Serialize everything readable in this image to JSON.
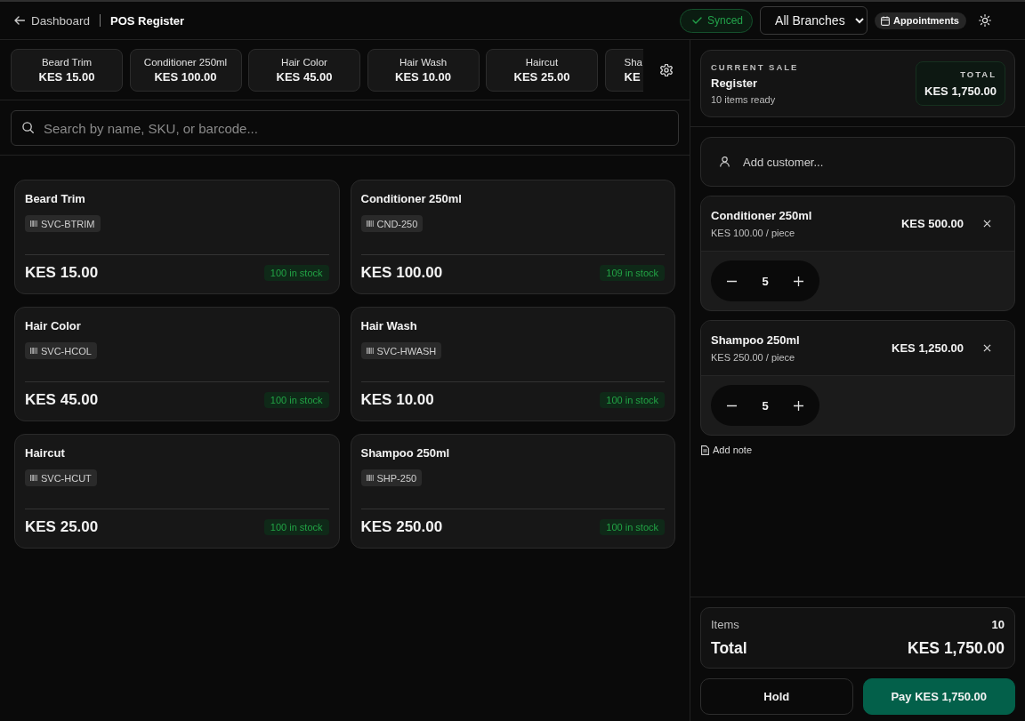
{
  "header": {
    "back_link": "Dashboard",
    "title": "POS Register",
    "sync_status": {
      "label": "Synced",
      "synced": true
    },
    "branch_select": {
      "value": "All Branches"
    },
    "appointments_button": "Appointments"
  },
  "quick_items": [
    {
      "name": "Beard Trim",
      "price": "KES 15.00",
      "cut_off": false
    },
    {
      "name": "Conditioner 250ml",
      "price": "KES 100.00",
      "cut_off": false
    },
    {
      "name": "Hair Color",
      "price": "KES 45.00",
      "cut_off": false
    },
    {
      "name": "Hair Wash",
      "price": "KES 10.00",
      "cut_off": false
    },
    {
      "name": "Haircut",
      "price": "KES 25.00",
      "cut_off": false
    },
    {
      "name": "Sha",
      "price": "KE",
      "cut_off": true
    }
  ],
  "search": {
    "placeholder": "Search by name, SKU, or barcode..."
  },
  "products": [
    {
      "name": "Beard Trim",
      "sku": "SVC-BTRIM",
      "price": "KES 15.00",
      "stock": "100 in stock"
    },
    {
      "name": "Conditioner 250ml",
      "sku": "CND-250",
      "price": "KES 100.00",
      "stock": "109 in stock"
    },
    {
      "name": "Hair Color",
      "sku": "SVC-HCOL",
      "price": "KES 45.00",
      "stock": "100 in stock"
    },
    {
      "name": "Hair Wash",
      "sku": "SVC-HWASH",
      "price": "KES 10.00",
      "stock": "100 in stock"
    },
    {
      "name": "Haircut",
      "sku": "SVC-HCUT",
      "price": "KES 25.00",
      "stock": "100 in stock"
    },
    {
      "name": "Shampoo 250ml",
      "sku": "SHP-250",
      "price": "KES 250.00",
      "stock": "100 in stock"
    }
  ],
  "current_sale": {
    "label": "CURRENT SALE",
    "title": "Register",
    "subtitle": "10 items ready",
    "total_label": "TOTAL",
    "total": "KES 1,750.00"
  },
  "customer": {
    "placeholder": "Add customer..."
  },
  "cart": [
    {
      "name": "Conditioner 250ml",
      "unit_price": "KES 100.00 / piece",
      "line_total": "KES 500.00",
      "quantity": "5"
    },
    {
      "name": "Shampoo 250ml",
      "unit_price": "KES 250.00 / piece",
      "line_total": "KES 1,250.00",
      "quantity": "5"
    }
  ],
  "add_note": "Add note",
  "summary": {
    "items_label": "Items",
    "items": "10",
    "total_label": "Total",
    "total": "KES 1,750.00"
  },
  "actions": [
    {
      "label": "Hold",
      "kind": "secondary"
    },
    {
      "label": "Pay KES 1,750.00",
      "kind": "primary"
    }
  ]
}
